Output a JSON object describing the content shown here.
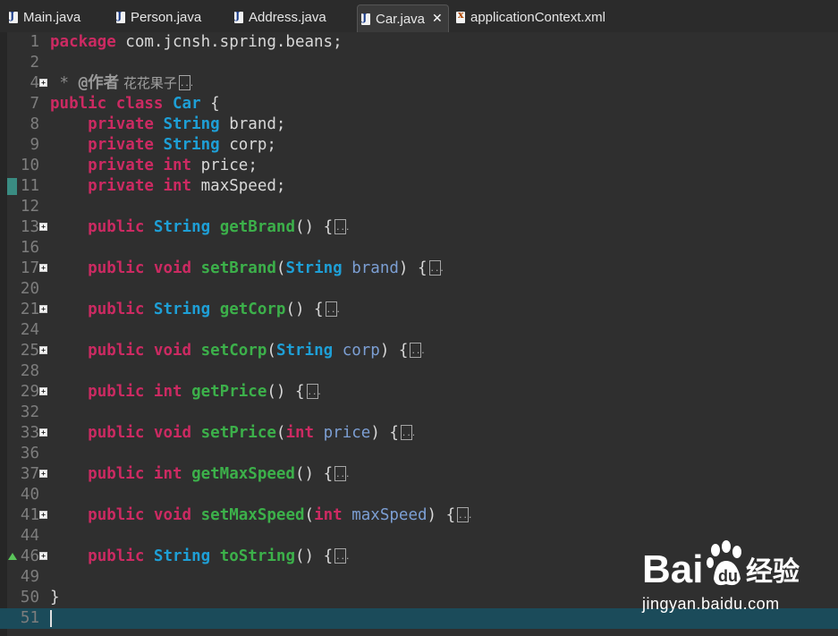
{
  "tabs": [
    {
      "label": "Main.java",
      "icon": "java-file-icon",
      "active": false
    },
    {
      "label": "Person.java",
      "icon": "java-file-icon",
      "active": false
    },
    {
      "label": "Address.java",
      "icon": "java-file-icon",
      "active": false
    },
    {
      "label": "Car.java",
      "icon": "java-file-icon",
      "active": true,
      "close": "✕"
    },
    {
      "label": "applicationContext.xml",
      "icon": "xml-file-icon",
      "active": false
    }
  ],
  "code": {
    "line_numbers": [
      "1",
      "2",
      "4",
      "7",
      "8",
      "9",
      "10",
      "11",
      "12",
      "13",
      "16",
      "17",
      "20",
      "21",
      "24",
      "25",
      "28",
      "29",
      "32",
      "33",
      "36",
      "37",
      "40",
      "41",
      "44",
      "46",
      "49",
      "50",
      "51"
    ],
    "package_kw": "package",
    "package_name": " com.jcnsh.spring.beans;",
    "comment_star": " * ",
    "comment_tag": "@作者",
    "comment_author": " 花花果子",
    "class_public": "public",
    "class_kw": "class",
    "class_name": "Car",
    "class_brace": " {",
    "fields": [
      {
        "mod": "private",
        "type": "String",
        "name": "brand",
        "semi": ";"
      },
      {
        "mod": "private",
        "type": "String",
        "name": "corp",
        "semi": ";"
      },
      {
        "mod": "private",
        "type": "int",
        "name": "price",
        "semi": ";"
      },
      {
        "mod": "private",
        "type": "int",
        "name": "maxSpeed",
        "semi": ";"
      }
    ],
    "methods": [
      {
        "mod": "public",
        "ret": "String",
        "name": "getBrand",
        "sig": "() {"
      },
      {
        "mod": "public",
        "ret": "void",
        "name": "setBrand",
        "ptype": "String",
        "pname": "brand",
        "close": ") {"
      },
      {
        "mod": "public",
        "ret": "String",
        "name": "getCorp",
        "sig": "() {"
      },
      {
        "mod": "public",
        "ret": "void",
        "name": "setCorp",
        "ptype": "String",
        "pname": "corp",
        "close": ") {"
      },
      {
        "mod": "public",
        "ret": "int",
        "name": "getPrice",
        "sig": "() {"
      },
      {
        "mod": "public",
        "ret": "void",
        "name": "setPrice",
        "ptype": "int",
        "pname": "price",
        "close": ") {"
      },
      {
        "mod": "public",
        "ret": "int",
        "name": "getMaxSpeed",
        "sig": "() {"
      },
      {
        "mod": "public",
        "ret": "void",
        "name": "setMaxSpeed",
        "ptype": "int",
        "pname": "maxSpeed",
        "close": ") {"
      },
      {
        "mod": "public",
        "ret": "String",
        "name": "toString",
        "sig": "() {"
      }
    ],
    "closing_brace": "}"
  },
  "watermark": {
    "brand": "Bai",
    "brand_cn": "经验",
    "url": "jingyan.baidu.com"
  },
  "colors": {
    "keyword": "#cc2a62",
    "type": "#1e9fd6",
    "method": "#3cb04a",
    "param": "#7c9fd4",
    "current_line": "#1b4b5a"
  }
}
